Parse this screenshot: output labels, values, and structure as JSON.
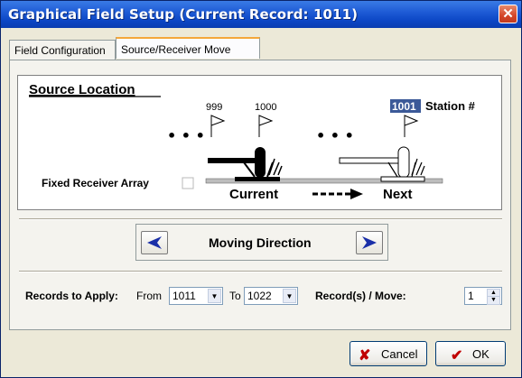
{
  "window": {
    "title": "Graphical Field Setup (Current Record: 1011)",
    "close_glyph": "✕"
  },
  "tabs": [
    {
      "label": "Field Configuration",
      "active": false
    },
    {
      "label": "Source/Receiver Move",
      "active": true
    }
  ],
  "diagram": {
    "heading": "Source Location",
    "flags": [
      "999",
      "1000",
      "1001"
    ],
    "station_label": "Station #",
    "dots": "• • •",
    "current_label": "Current",
    "next_label": "Next"
  },
  "fixed_receiver": {
    "label": "Fixed Receiver Array",
    "checked": false
  },
  "moving_direction": {
    "label": "Moving Direction",
    "left_icon": "left-arrow-icon",
    "right_icon": "right-arrow-icon"
  },
  "records": {
    "label": "Records to Apply:",
    "from_label": "From",
    "from_value": "1011",
    "to_label": "To",
    "to_value": "1022",
    "per_move_label": "Record(s) / Move:",
    "per_move_value": "1"
  },
  "buttons": {
    "cancel": "Cancel",
    "ok": "OK"
  },
  "colors": {
    "title_bar": "#0b45c4",
    "arrow": "#1a2fa8",
    "cancel_x": "#c00000",
    "ok_check": "#c00000"
  }
}
